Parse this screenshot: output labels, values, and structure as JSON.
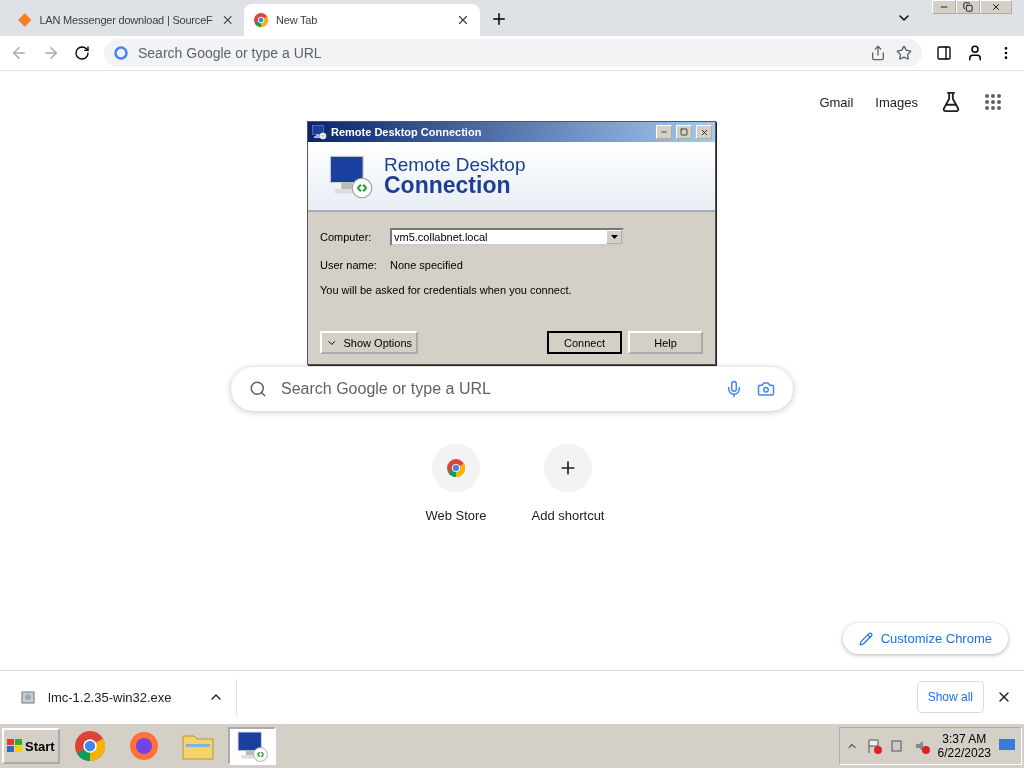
{
  "tabs": [
    {
      "title": "LAN Messenger download | SourceF",
      "kind": "site",
      "selected": false
    },
    {
      "title": "New Tab",
      "kind": "chrome",
      "selected": true
    }
  ],
  "address": {
    "placeholder": "Search Google or type a URL"
  },
  "header_links": [
    "Gmail",
    "Images"
  ],
  "dialog": {
    "title": "Remote Desktop Connection",
    "heading_line1": "Remote Desktop",
    "heading_line2": "Connection",
    "computer": {
      "label": "Computer:",
      "value": "vm5.collabnet.local"
    },
    "user": {
      "label": "User name:",
      "value": "None specified"
    },
    "note": "You will be asked for credentials when you connect.",
    "options_button": "Show Options",
    "buttons": [
      {
        "label": "Connect",
        "default": true
      },
      {
        "label": "Help",
        "default": false
      }
    ]
  },
  "search": {
    "placeholder": "Search Google or type a URL"
  },
  "shortcuts": [
    {
      "label": "Web Store",
      "kind": "store"
    },
    {
      "label": "Add shortcut",
      "kind": "add"
    }
  ],
  "customize": "Customize Chrome",
  "download": {
    "filename": "lmc-1.2.35-win32.exe",
    "show_all": "Show all"
  },
  "taskbar": {
    "start": "Start",
    "apps": [
      {
        "kind": "chrome",
        "selected": false
      },
      {
        "kind": "firefox",
        "selected": false
      },
      {
        "kind": "folder",
        "selected": false
      },
      {
        "kind": "rdp",
        "selected": true
      }
    ],
    "time": "3:37 AM",
    "date": "6/22/2023"
  }
}
